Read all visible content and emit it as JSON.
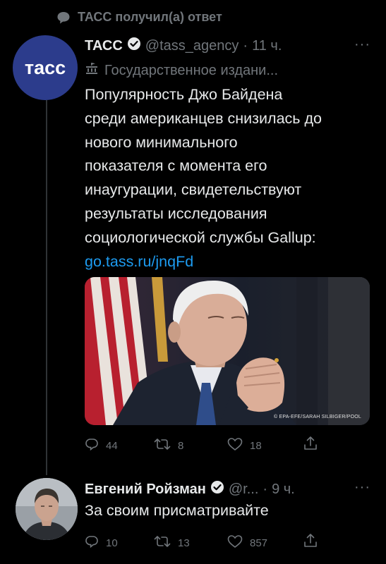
{
  "context": {
    "text": "ТАСС получил(а) ответ",
    "icon": "speech-bubble-icon"
  },
  "tweet": {
    "author_name": "ТАСС",
    "handle": "@tass_agency",
    "separator": "·",
    "time": "11 ч.",
    "verified_icon": "verified-badge-icon",
    "more_icon": "more-icon",
    "more": "···",
    "avatar_text": "тасс",
    "label_icon": "government-building-icon",
    "label": "Государственное издани...",
    "text_lines": [
      "Популярность Джо Байдена",
      "среди американцев снизилась до",
      "нового минимального",
      "показателя с момента его",
      "инаугурации, свидетельствуют",
      "результаты исследования",
      "социологической службы Gallup:"
    ],
    "link": "go.tass.ru/jnqFd",
    "media_credit": "© EPA-EFE/SARAH SILBIGER/POOL",
    "stats": {
      "replies": "44",
      "retweets": "8",
      "likes": "18"
    }
  },
  "reply": {
    "author_name": "Евгений Ройзман",
    "handle": "@r...",
    "separator": "·",
    "time": "9 ч.",
    "more": "···",
    "text": "За своим присматривайте",
    "stats": {
      "replies": "10",
      "retweets": "13",
      "likes": "857"
    }
  },
  "colors": {
    "background": "#000000",
    "text": "#e7e9ea",
    "muted": "#71767b",
    "link": "#1d9bf0",
    "tass_brand": "#2c3c8c"
  }
}
